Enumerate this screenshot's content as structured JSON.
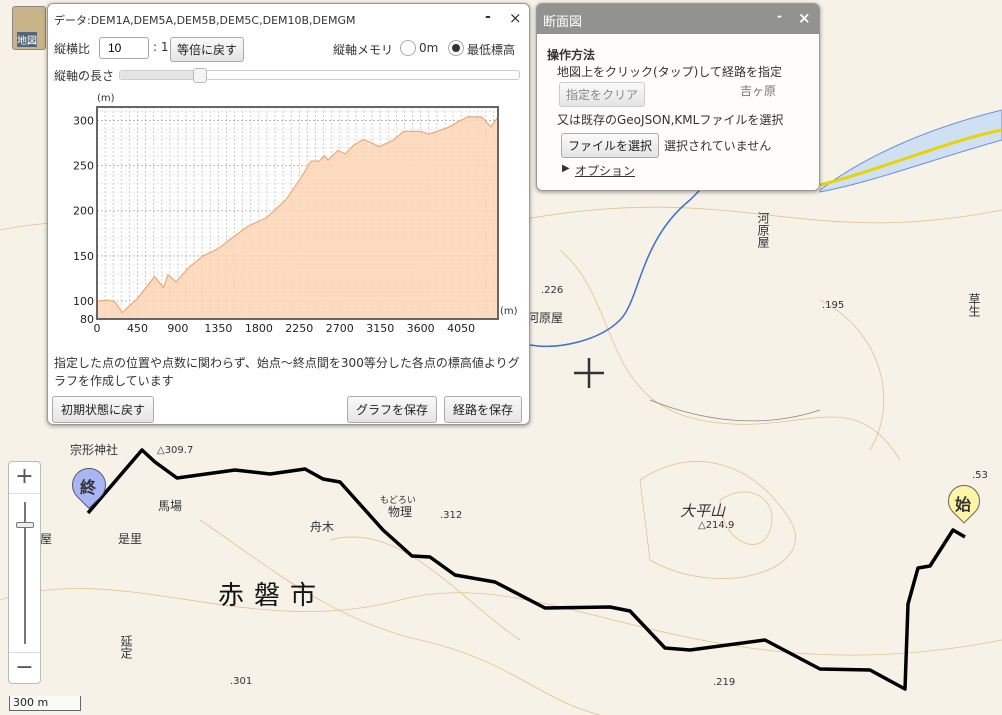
{
  "map": {
    "labels": {
      "shrine": "宗形神社",
      "pt3097": "△309.7",
      "baba": "馬場",
      "zeri": "是里",
      "funaki": "舟木",
      "motoroi": "もどろい",
      "butsuri": "物理",
      "pt312": ".312",
      "akaiwa": "赤磐市",
      "nobesada": "延定",
      "pt301": ".301",
      "taiheiyama": "大平山",
      "pt2149": "△214.9",
      "pt219": ".219",
      "pt226": ".226",
      "kawaharaya": "河原屋",
      "kawaharaya2": "河原屋",
      "pt195": ".195",
      "kusabu": "草生",
      "pt53": ".53",
      "yoshigahara": "吉ヶ原",
      "ya": "屋",
      "chizu": "地図"
    },
    "start_marker": "始",
    "end_marker": "終",
    "scale": "300 m",
    "zoom_in": "+",
    "zoom_out": "−",
    "route_color": "#000000"
  },
  "profile_window": {
    "title": "データ:DEM1A,DEM5A,DEM5B,DEM5C,DEM10B,DEMGM",
    "minimize": "-",
    "close": "×",
    "aspect_label": "縦横比",
    "aspect_value": "10",
    "aspect_suffix": ": 1",
    "reset_aspect": "等倍に戻す",
    "axis_memory_label": "縦軸メモリ",
    "opt_0m": "0m",
    "opt_min": "最低標高",
    "selected": "最低標高",
    "axis_length_label": "縦軸の長さ",
    "axis_length_value": 0.2,
    "note": "指定した点の位置や点数に関わらず、始点～終点間を300等分した各点の標高値よりグラフを作成しています",
    "reset_button": "初期状態に戻す",
    "save_graph": "グラフを保存",
    "save_route": "経路を保存"
  },
  "section_window": {
    "title": "断面図",
    "minimize": "-",
    "close": "×",
    "howto": "操作方法",
    "step1": "地図上をクリック(タップ)して経路を指定",
    "clear_button": "指定をクリア",
    "step2": "又は既存のGeoJSON,KMLファイルを選択",
    "file_button": "ファイルを選択",
    "file_status": "選択されていません",
    "options": "オプション"
  },
  "chart_data": {
    "type": "area",
    "xlabel": "(m)",
    "ylabel": "(m)",
    "xlim": [
      0,
      4460
    ],
    "ylim": [
      80,
      315
    ],
    "xticks": [
      0,
      450,
      900,
      1350,
      1800,
      2250,
      2700,
      3150,
      3600,
      4050
    ],
    "yticks": [
      80,
      100,
      150,
      200,
      250,
      300
    ],
    "fill": "#fbd5b5",
    "line": "#f0a878",
    "points": [
      [
        0,
        100
      ],
      [
        130,
        101
      ],
      [
        200,
        99
      ],
      [
        280,
        87
      ],
      [
        450,
        103
      ],
      [
        640,
        127
      ],
      [
        740,
        115
      ],
      [
        790,
        129
      ],
      [
        880,
        121
      ],
      [
        1020,
        137
      ],
      [
        1180,
        150
      ],
      [
        1350,
        158
      ],
      [
        1530,
        172
      ],
      [
        1680,
        183
      ],
      [
        1880,
        192
      ],
      [
        2100,
        212
      ],
      [
        2270,
        237
      ],
      [
        2380,
        255
      ],
      [
        2470,
        255
      ],
      [
        2530,
        261
      ],
      [
        2570,
        256
      ],
      [
        2680,
        267
      ],
      [
        2760,
        263
      ],
      [
        2860,
        273
      ],
      [
        2960,
        279
      ],
      [
        3040,
        276
      ],
      [
        3140,
        271
      ],
      [
        3290,
        278
      ],
      [
        3410,
        288
      ],
      [
        3600,
        288
      ],
      [
        3690,
        285
      ],
      [
        3900,
        292
      ],
      [
        4120,
        304
      ],
      [
        4280,
        304
      ],
      [
        4380,
        293
      ],
      [
        4460,
        304
      ]
    ]
  }
}
